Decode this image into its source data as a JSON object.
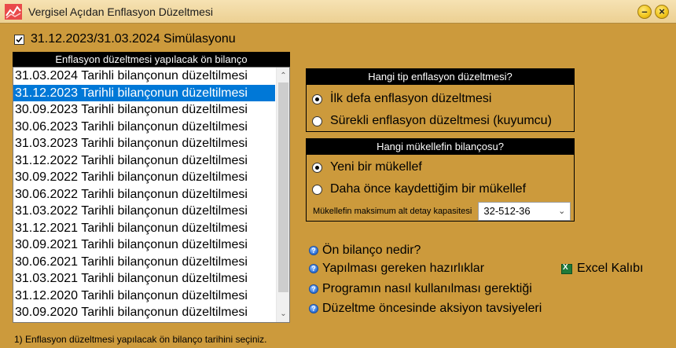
{
  "window": {
    "title": "Vergisel Açıdan Enflasyon Düzeltmesi",
    "minimize_label": "–",
    "close_label": "×"
  },
  "simulation": {
    "label": "31.12.2023/31.03.2024 Simülasyonu",
    "checked": true
  },
  "balance_list": {
    "header": "Enflasyon düzeltmesi yapılacak ön bilanço",
    "items": [
      "31.03.2024 Tarihli bilançonun düzeltilmesi",
      "31.12.2023 Tarihli bilançonun düzeltilmesi",
      "30.09.2023 Tarihli bilançonun düzeltilmesi",
      "30.06.2023 Tarihli bilançonun düzeltilmesi",
      "31.03.2023 Tarihli bilançonun düzeltilmesi",
      "31.12.2022 Tarihli bilançonun düzeltilmesi",
      "30.09.2022 Tarihli bilançonun düzeltilmesi",
      "30.06.2022 Tarihli bilançonun düzeltilmesi",
      "31.03.2022 Tarihli bilançonun düzeltilmesi",
      "31.12.2021 Tarihli bilançonun düzeltilmesi",
      "30.09.2021 Tarihli bilançonun düzeltilmesi",
      "30.06.2021 Tarihli bilançonun düzeltilmesi",
      "31.03.2021 Tarihli bilançonun düzeltilmesi",
      "31.12.2020 Tarihli bilançonun düzeltilmesi",
      "30.09.2020 Tarihli bilançonun düzeltilmesi"
    ],
    "selected_index": 1
  },
  "correction_type": {
    "header": "Hangi tip enflasyon düzeltmesi?",
    "options": [
      "İlk defa enflasyon düzeltmesi",
      "Sürekli enflasyon düzeltmesi (kuyumcu)"
    ],
    "selected_index": 0
  },
  "taxpayer": {
    "header": "Hangi mükellefin bilançosu?",
    "options": [
      "Yeni bir mükellef",
      "Daha önce kaydettiğim bir mükellef"
    ],
    "selected_index": 0,
    "capacity_label": "Mükellefin maksimum alt detay kapasitesi",
    "capacity_value": "32-512-36"
  },
  "help_links": [
    "Ön bilanço nedir?",
    "Yapılması gereken hazırlıklar",
    "Programın nasıl kullanılması gerektiği",
    "Düzeltme öncesinde aksiyon tavsiyeleri"
  ],
  "excel_template_label": "Excel Kalıbı",
  "status_text": "1) Enflasyon düzeltmesi yapılacak ön bilanço tarihini seçiniz.",
  "colors": {
    "background": "#cc9a3c",
    "selection": "#0078d7",
    "header_bar": "#000000"
  }
}
